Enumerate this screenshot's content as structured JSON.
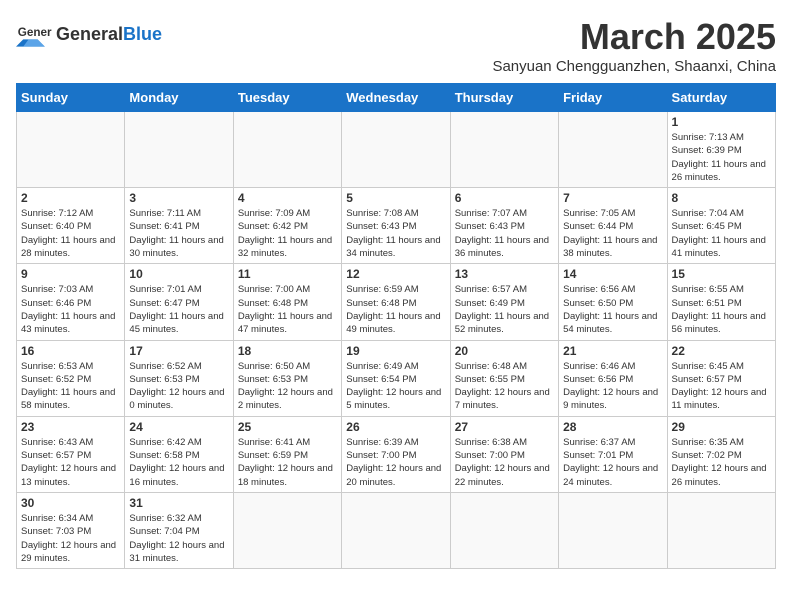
{
  "header": {
    "logo_general": "General",
    "logo_blue": "Blue",
    "month_title": "March 2025",
    "location": "Sanyuan Chengguanzhen, Shaanxi, China"
  },
  "weekdays": [
    "Sunday",
    "Monday",
    "Tuesday",
    "Wednesday",
    "Thursday",
    "Friday",
    "Saturday"
  ],
  "weeks": [
    [
      {
        "day": "",
        "info": ""
      },
      {
        "day": "",
        "info": ""
      },
      {
        "day": "",
        "info": ""
      },
      {
        "day": "",
        "info": ""
      },
      {
        "day": "",
        "info": ""
      },
      {
        "day": "",
        "info": ""
      },
      {
        "day": "1",
        "info": "Sunrise: 7:13 AM\nSunset: 6:39 PM\nDaylight: 11 hours and 26 minutes."
      }
    ],
    [
      {
        "day": "2",
        "info": "Sunrise: 7:12 AM\nSunset: 6:40 PM\nDaylight: 11 hours and 28 minutes."
      },
      {
        "day": "3",
        "info": "Sunrise: 7:11 AM\nSunset: 6:41 PM\nDaylight: 11 hours and 30 minutes."
      },
      {
        "day": "4",
        "info": "Sunrise: 7:09 AM\nSunset: 6:42 PM\nDaylight: 11 hours and 32 minutes."
      },
      {
        "day": "5",
        "info": "Sunrise: 7:08 AM\nSunset: 6:43 PM\nDaylight: 11 hours and 34 minutes."
      },
      {
        "day": "6",
        "info": "Sunrise: 7:07 AM\nSunset: 6:43 PM\nDaylight: 11 hours and 36 minutes."
      },
      {
        "day": "7",
        "info": "Sunrise: 7:05 AM\nSunset: 6:44 PM\nDaylight: 11 hours and 38 minutes."
      },
      {
        "day": "8",
        "info": "Sunrise: 7:04 AM\nSunset: 6:45 PM\nDaylight: 11 hours and 41 minutes."
      }
    ],
    [
      {
        "day": "9",
        "info": "Sunrise: 7:03 AM\nSunset: 6:46 PM\nDaylight: 11 hours and 43 minutes."
      },
      {
        "day": "10",
        "info": "Sunrise: 7:01 AM\nSunset: 6:47 PM\nDaylight: 11 hours and 45 minutes."
      },
      {
        "day": "11",
        "info": "Sunrise: 7:00 AM\nSunset: 6:48 PM\nDaylight: 11 hours and 47 minutes."
      },
      {
        "day": "12",
        "info": "Sunrise: 6:59 AM\nSunset: 6:48 PM\nDaylight: 11 hours and 49 minutes."
      },
      {
        "day": "13",
        "info": "Sunrise: 6:57 AM\nSunset: 6:49 PM\nDaylight: 11 hours and 52 minutes."
      },
      {
        "day": "14",
        "info": "Sunrise: 6:56 AM\nSunset: 6:50 PM\nDaylight: 11 hours and 54 minutes."
      },
      {
        "day": "15",
        "info": "Sunrise: 6:55 AM\nSunset: 6:51 PM\nDaylight: 11 hours and 56 minutes."
      }
    ],
    [
      {
        "day": "16",
        "info": "Sunrise: 6:53 AM\nSunset: 6:52 PM\nDaylight: 11 hours and 58 minutes."
      },
      {
        "day": "17",
        "info": "Sunrise: 6:52 AM\nSunset: 6:53 PM\nDaylight: 12 hours and 0 minutes."
      },
      {
        "day": "18",
        "info": "Sunrise: 6:50 AM\nSunset: 6:53 PM\nDaylight: 12 hours and 2 minutes."
      },
      {
        "day": "19",
        "info": "Sunrise: 6:49 AM\nSunset: 6:54 PM\nDaylight: 12 hours and 5 minutes."
      },
      {
        "day": "20",
        "info": "Sunrise: 6:48 AM\nSunset: 6:55 PM\nDaylight: 12 hours and 7 minutes."
      },
      {
        "day": "21",
        "info": "Sunrise: 6:46 AM\nSunset: 6:56 PM\nDaylight: 12 hours and 9 minutes."
      },
      {
        "day": "22",
        "info": "Sunrise: 6:45 AM\nSunset: 6:57 PM\nDaylight: 12 hours and 11 minutes."
      }
    ],
    [
      {
        "day": "23",
        "info": "Sunrise: 6:43 AM\nSunset: 6:57 PM\nDaylight: 12 hours and 13 minutes."
      },
      {
        "day": "24",
        "info": "Sunrise: 6:42 AM\nSunset: 6:58 PM\nDaylight: 12 hours and 16 minutes."
      },
      {
        "day": "25",
        "info": "Sunrise: 6:41 AM\nSunset: 6:59 PM\nDaylight: 12 hours and 18 minutes."
      },
      {
        "day": "26",
        "info": "Sunrise: 6:39 AM\nSunset: 7:00 PM\nDaylight: 12 hours and 20 minutes."
      },
      {
        "day": "27",
        "info": "Sunrise: 6:38 AM\nSunset: 7:00 PM\nDaylight: 12 hours and 22 minutes."
      },
      {
        "day": "28",
        "info": "Sunrise: 6:37 AM\nSunset: 7:01 PM\nDaylight: 12 hours and 24 minutes."
      },
      {
        "day": "29",
        "info": "Sunrise: 6:35 AM\nSunset: 7:02 PM\nDaylight: 12 hours and 26 minutes."
      }
    ],
    [
      {
        "day": "30",
        "info": "Sunrise: 6:34 AM\nSunset: 7:03 PM\nDaylight: 12 hours and 29 minutes."
      },
      {
        "day": "31",
        "info": "Sunrise: 6:32 AM\nSunset: 7:04 PM\nDaylight: 12 hours and 31 minutes."
      },
      {
        "day": "",
        "info": ""
      },
      {
        "day": "",
        "info": ""
      },
      {
        "day": "",
        "info": ""
      },
      {
        "day": "",
        "info": ""
      },
      {
        "day": "",
        "info": ""
      }
    ]
  ]
}
